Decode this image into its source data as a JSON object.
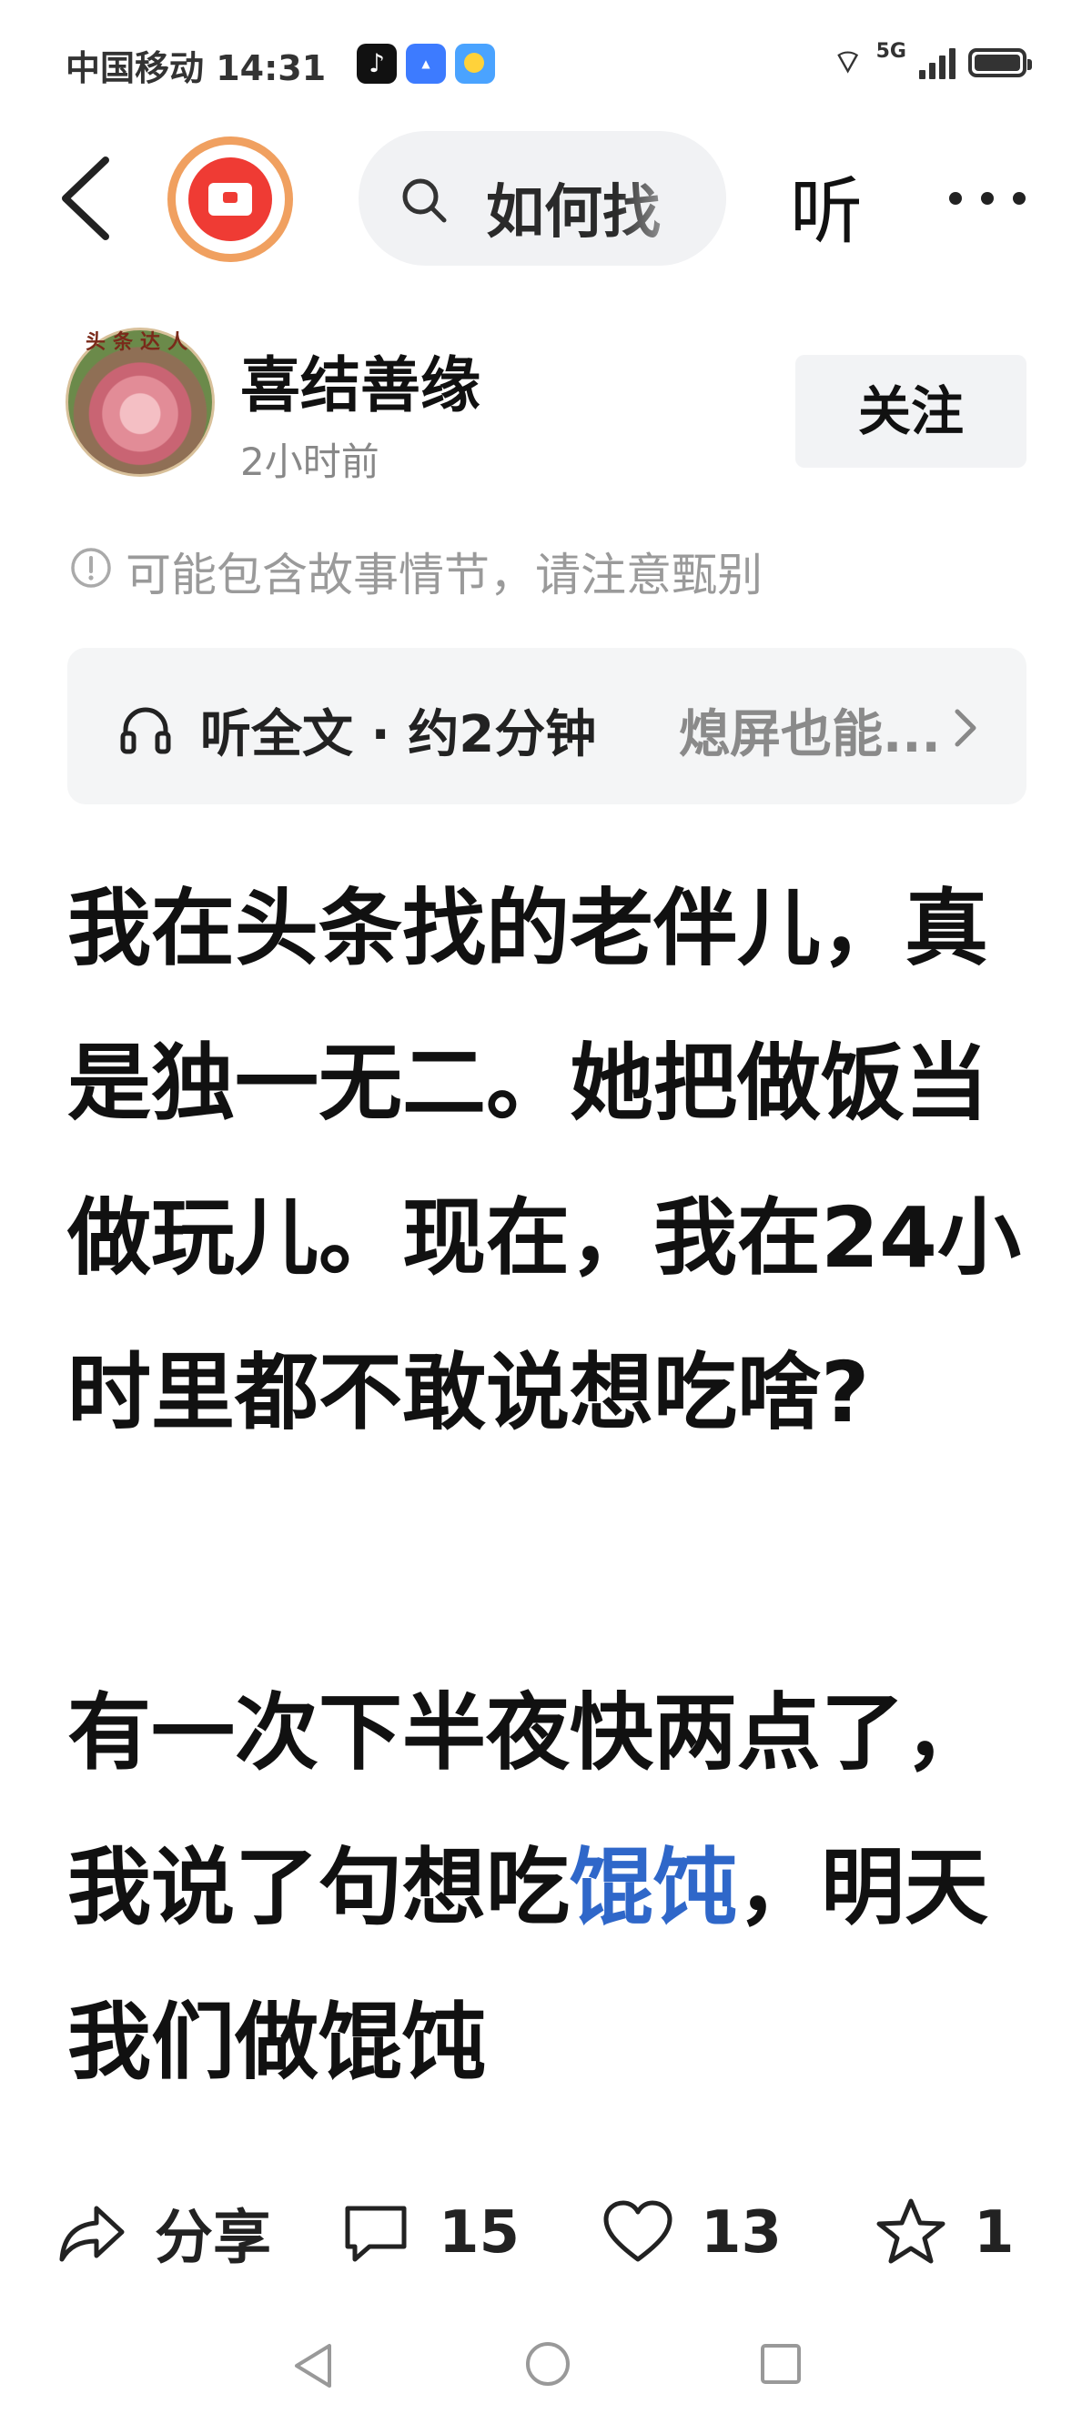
{
  "status_bar": {
    "carrier_time": "中国移动 14:31",
    "network": "5G",
    "icons": [
      "tiktok-icon",
      "app-market-icon",
      "weather-icon",
      "wifi-icon",
      "signal-icon",
      "battery-icon"
    ]
  },
  "nav": {
    "search_text": "如何找",
    "listen_label": "听",
    "icons": [
      "back-icon",
      "red-packet-icon",
      "search-icon",
      "more-icon"
    ]
  },
  "author": {
    "avatar_ribbon": "头条达人",
    "name": "喜结善缘",
    "time": "2小时前",
    "follow_label": "关注"
  },
  "warning": {
    "text": "可能包含故事情节，请注意甄别"
  },
  "listen_bar": {
    "full_text_label": "听全文 · 约2分钟",
    "screen_off_label": "熄屏也能..."
  },
  "article": {
    "paragraph1": "我在头条找的老伴儿，真是独一无二。她把做饭当做玩儿。现在，我在24小时里都不敢说想吃啥?",
    "paragraph2_part1": "有一次下半夜快两点了，我说了句想吃",
    "paragraph2_link": "馄饨",
    "paragraph2_part2": "，明天我们做馄饨"
  },
  "actions": {
    "share_label": "分享",
    "comment_count": "15",
    "like_count": "13",
    "favorite_count": "1"
  },
  "colors": {
    "link": "#2f67c9",
    "follow_bg": "#f2f3f5",
    "red_packet": "#ef3b34"
  }
}
